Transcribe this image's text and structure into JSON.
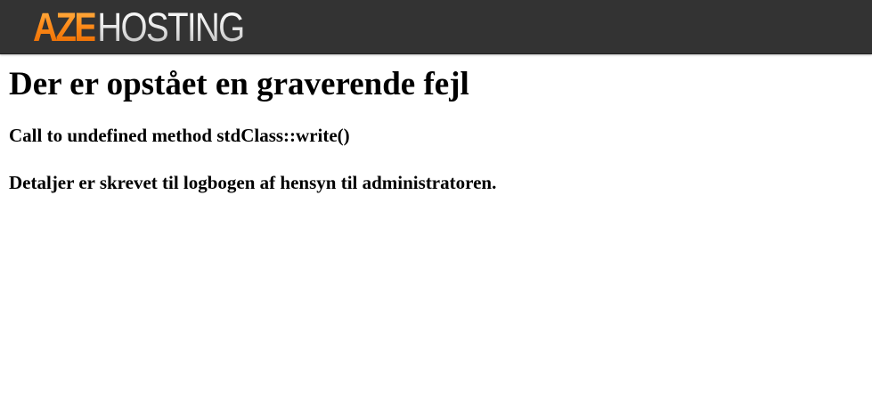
{
  "header": {
    "logo_part1": "AZE",
    "logo_part2": "HOSTING",
    "background_color": "#333333",
    "accent_color": "#ff8c1a"
  },
  "error": {
    "title": "Der er opstået en graverende fejl",
    "message": "Call to undefined method stdClass::write()",
    "details": "Detaljer er skrevet til logbogen af hensyn til administratoren."
  }
}
